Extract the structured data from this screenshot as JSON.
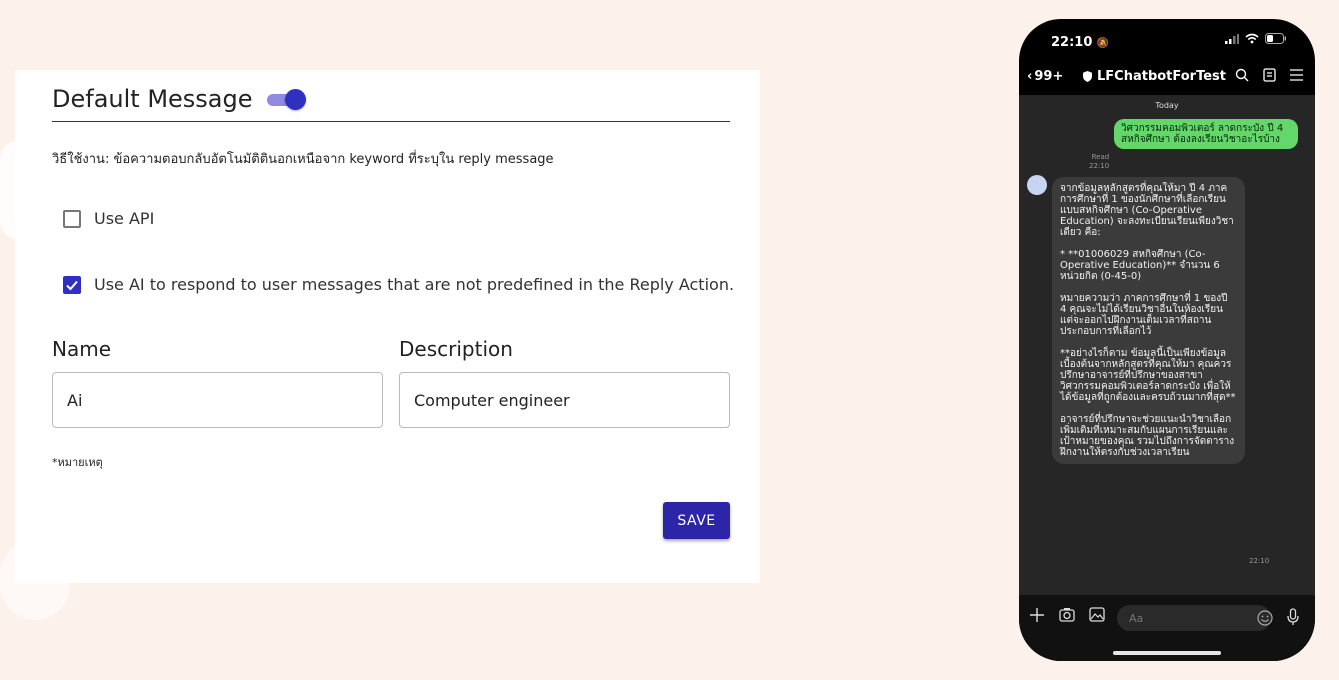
{
  "settings": {
    "title": "Default Message",
    "default_message_enabled": true,
    "usage_text": "วิธีใช้งาน: ข้อความตอบกลับอัตโนมัติตินอกเหนือจาก keyword ที่ระบุใน reply message",
    "use_api": {
      "label": "Use API",
      "checked": false
    },
    "use_ai": {
      "label": "Use AI to respond to user messages that are not predefined in the Reply Action.",
      "checked": true
    },
    "name": {
      "label": "Name",
      "value": "Ai"
    },
    "description": {
      "label": "Description",
      "value": "Computer engineer"
    },
    "note": "*หมายเหตุ",
    "save_label": "SAVE",
    "accent_color": "#2c25a8"
  },
  "phone": {
    "time": "22:10",
    "back_label": "99+",
    "chat_name": "LFChatbotForTest",
    "date_label": "Today",
    "outgoing": {
      "text": "วิศวกรรมคอมพิวเตอร์ ลาดกระบัง ปี 4 สหกิจศึกษา ต้องลงเรียนวิชาอะไรบ้าง",
      "read_label": "Read",
      "time": "22:10"
    },
    "incoming": {
      "paragraphs": [
        "จากข้อมูลหลักสูตรที่คุณให้มา ปี 4 ภาคการศึกษาที่ 1 ของนักศึกษาที่เลือกเรียนแบบสหกิจศึกษา (Co-Operative Education) จะลงทะเบียนเรียนเพียงวิชาเดียว คือ:",
        "* **01006029 สหกิจศึกษา (Co-Operative Education)** จำนวน 6 หน่วยกิต (0-45-0)",
        "หมายความว่า ภาคการศึกษาที่ 1 ของปี 4 คุณจะไม่ได้เรียนวิชาอื่นในห้องเรียน แต่จะออกไปฝึกงานเต็มเวลาที่สถานประกอบการที่เลือกไว้",
        "**อย่างไรก็ตาม ข้อมูลนี้เป็นเพียงข้อมูลเบื้องต้นจากหลักสูตรที่คุณให้มา คุณควรปรึกษาอาจารย์ที่ปรึกษาของสาขาวิศวกรรมคอมพิวเตอร์ลาดกระบัง เพื่อให้ได้ข้อมูลที่ถูกต้องและครบถ้วนมากที่สุด**",
        "อาจารย์ที่ปรึกษาจะช่วยแนะนำวิชาเลือกเพิ่มเติมที่เหมาะสมกับแผนการเรียนและเป้าหมายของคุณ รวมไปถึงการจัดตารางฝึกงานให้ตรงกับช่วงเวลาเรียน"
      ],
      "time": "22:10"
    },
    "input_placeholder": "Aa",
    "bubble_out_color": "#64d76b"
  }
}
